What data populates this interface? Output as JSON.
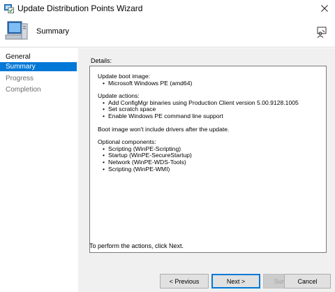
{
  "window": {
    "title": "Update Distribution Points Wizard"
  },
  "header": {
    "title": "Summary"
  },
  "sidebar": {
    "items": [
      {
        "label": "General"
      },
      {
        "label": "Summary"
      },
      {
        "label": "Progress"
      },
      {
        "label": "Completion"
      }
    ]
  },
  "content": {
    "details_label": "Details:",
    "details": {
      "boot_image_heading": "Update boot image:",
      "boot_image": [
        "Microsoft Windows PE (amd64)"
      ],
      "actions_heading": "Update actions:",
      "actions": [
        "Add ConfigMgr binaries using Production Client version 5.00.9128.1005",
        "Set scratch space",
        "Enable Windows PE command line support"
      ],
      "driver_note": "Boot image won't include drivers after the update.",
      "components_heading": "Optional components:",
      "components": [
        "Scripting (WinPE-Scripting)",
        "Startup (WinPE-SecureStartup)",
        "Network (WinPE-WDS-Tools)",
        "Scripting (WinPE-WMI)"
      ]
    },
    "instruction": "To perform the actions, click Next."
  },
  "buttons": {
    "previous": "< Previous",
    "next": "Next >",
    "summary": "Summary",
    "cancel": "Cancel"
  },
  "colors": {
    "accent": "#0078d7",
    "panel": "#f0f0f0"
  }
}
